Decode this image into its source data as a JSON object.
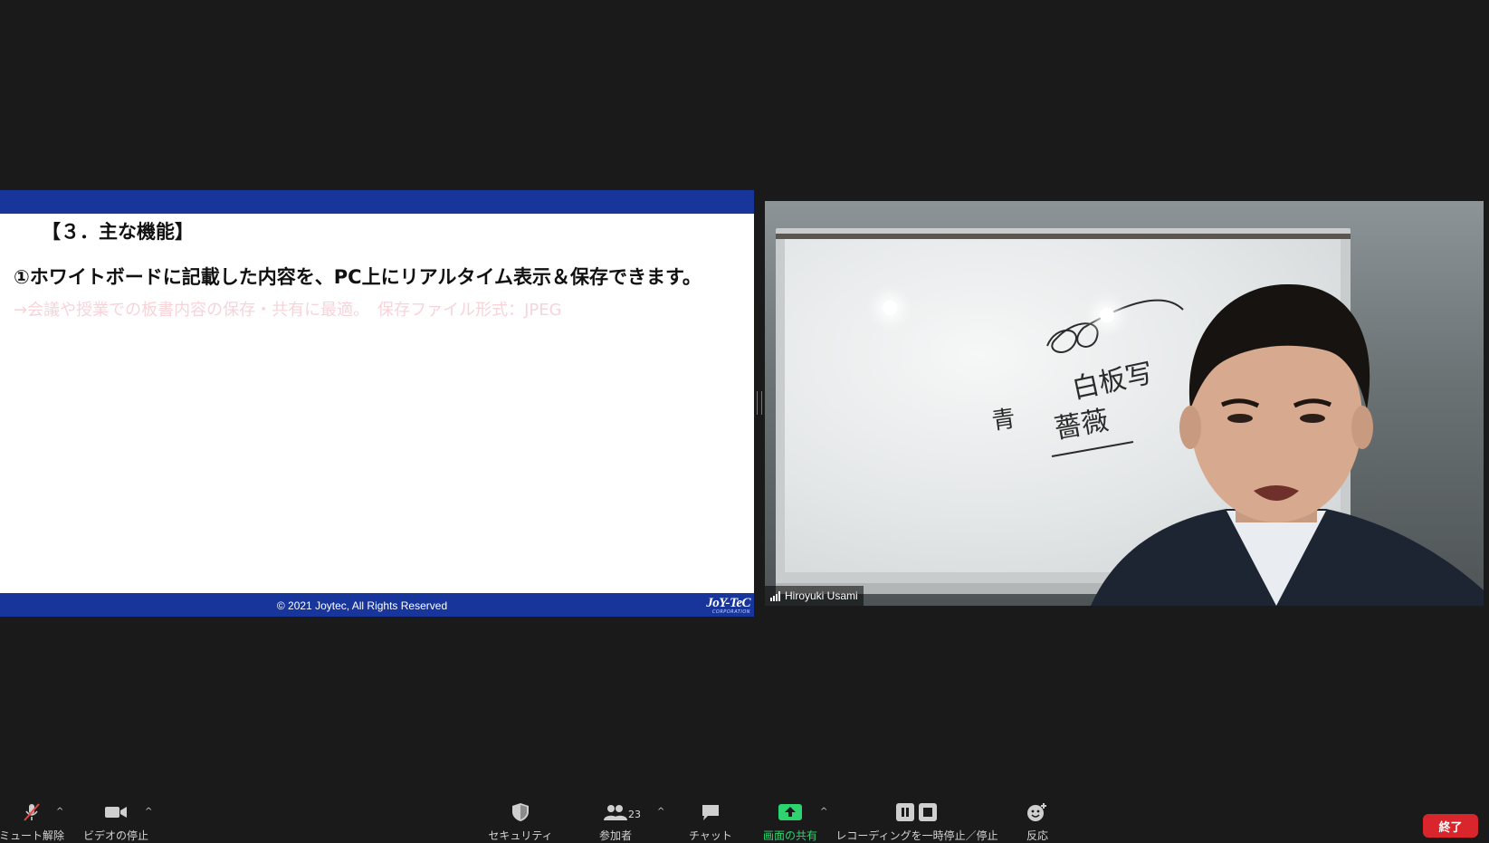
{
  "slide": {
    "heading": "【３．主な機能】",
    "feature": "①ホワイトボードに記載した内容を、PC上にリアルタイム表示＆保存できます。",
    "subtitle": "→会議や授業での板書内容の保存・共有に最適。　保存ファイル形式：JPEG",
    "copyright": "© 2021 Joytec, All Rights Reserved",
    "logo_main": "JoY-TeC",
    "logo_sub": "CORPORATION"
  },
  "video": {
    "participant_name": "Hiroyuki Usami",
    "board_writing": [
      "白板写",
      "青",
      "薔薇"
    ]
  },
  "toolbar": {
    "mute": {
      "label": "ミュート解除",
      "icon": "muted-mic-icon"
    },
    "video": {
      "label": "ビデオの停止",
      "icon": "video-camera-icon"
    },
    "security": {
      "label": "セキュリティ",
      "icon": "shield-icon"
    },
    "participants": {
      "label": "参加者",
      "count": "23",
      "icon": "people-icon"
    },
    "chat": {
      "label": "チャット",
      "icon": "chat-bubble-icon"
    },
    "share": {
      "label": "画面の共有",
      "icon": "share-screen-icon"
    },
    "recording": {
      "label": "レコーディングを一時停止／停止",
      "icon": "pause-stop-icon"
    },
    "reactions": {
      "label": "反応",
      "icon": "emoji-add-icon"
    },
    "end": {
      "label": "終了"
    }
  },
  "colors": {
    "background": "#1a1a1a",
    "slide_band": "#17359b",
    "share_green": "#2dd36f",
    "end_red": "#d9262c"
  }
}
